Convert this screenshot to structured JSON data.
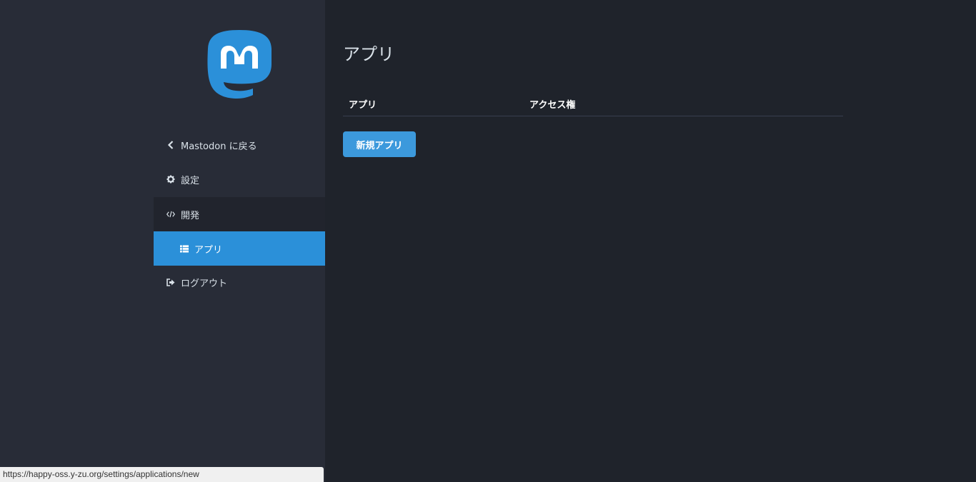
{
  "sidebar": {
    "back_label": "Mastodon に戻る",
    "settings_label": "設定",
    "development_label": "開発",
    "apps_label": "アプリ",
    "logout_label": "ログアウト"
  },
  "main": {
    "title": "アプリ",
    "table": {
      "columns": [
        "アプリ",
        "アクセス権"
      ],
      "rows": []
    },
    "new_app_button": "新規アプリ"
  },
  "statusbar": {
    "url": "https://happy-oss.y-zu.org/settings/applications/new"
  },
  "colors": {
    "accent": "#2b90d9",
    "button": "#3c99dc",
    "sidebar_bg": "#282c37",
    "main_bg": "#1f232b"
  },
  "icons": {
    "back": "chevron-left-icon",
    "settings": "gear-icon",
    "development": "code-icon",
    "apps": "list-icon",
    "logout": "sign-out-icon",
    "logo": "mastodon-logo"
  }
}
